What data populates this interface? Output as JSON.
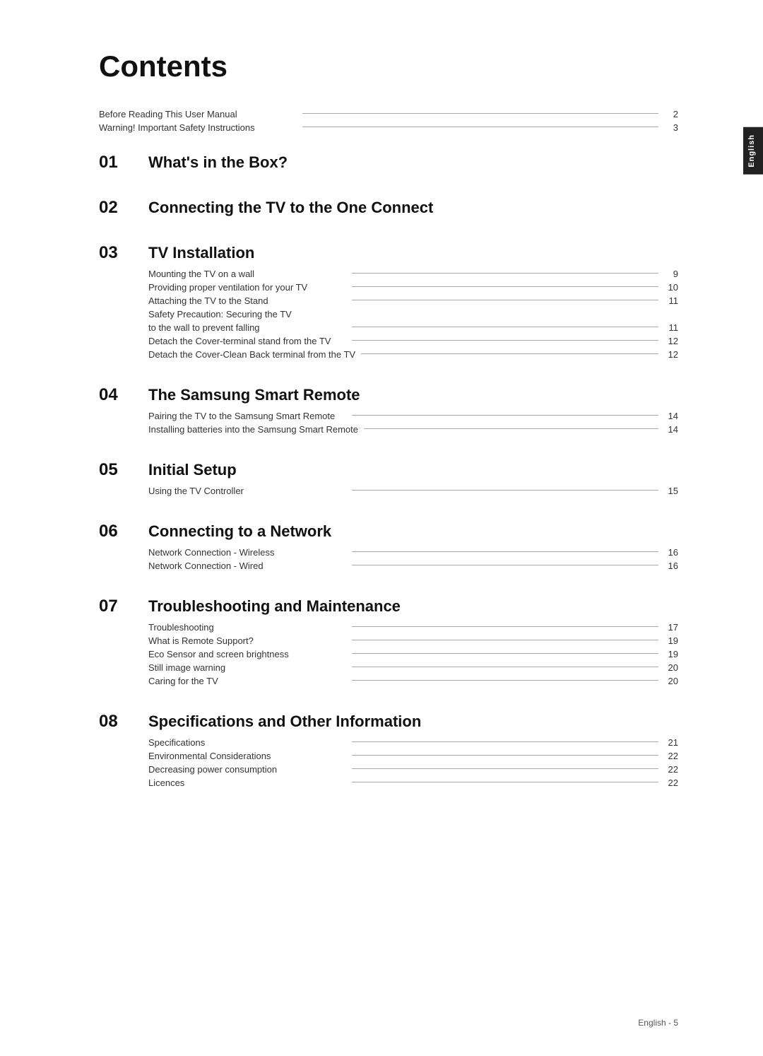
{
  "page": {
    "title": "Contents",
    "footer": "English - 5",
    "side_tab": "English"
  },
  "intro": {
    "items": [
      {
        "label": "Before Reading This User Manual",
        "page": "2"
      },
      {
        "label": "Warning! Important Safety Instructions",
        "page": "3"
      }
    ]
  },
  "sections": [
    {
      "number": "01",
      "title": "What's in the Box?",
      "entries": []
    },
    {
      "number": "02",
      "title": "Connecting the TV to the One Connect",
      "entries": []
    },
    {
      "number": "03",
      "title": "TV Installation",
      "entries": [
        {
          "label": "Mounting the TV on a wall",
          "page": "9"
        },
        {
          "label": "Providing proper ventilation for your TV",
          "page": "10"
        },
        {
          "label": "Attaching the TV to the Stand",
          "page": "11"
        },
        {
          "label": "Safety Precaution: Securing the TV",
          "page": ""
        },
        {
          "label": "to the wall to prevent falling",
          "page": "11"
        },
        {
          "label": "Detach the Cover-terminal stand from the TV",
          "page": "12"
        },
        {
          "label": "Detach the Cover-Clean Back terminal from the TV",
          "page": "12"
        }
      ]
    },
    {
      "number": "04",
      "title": "The Samsung Smart Remote",
      "entries": [
        {
          "label": "Pairing the TV to the Samsung Smart Remote",
          "page": "14"
        },
        {
          "label": "Installing batteries into the Samsung Smart Remote",
          "page": "14"
        }
      ]
    },
    {
      "number": "05",
      "title": "Initial Setup",
      "entries": [
        {
          "label": "Using the TV Controller",
          "page": "15"
        }
      ]
    },
    {
      "number": "06",
      "title": "Connecting to a Network",
      "entries": [
        {
          "label": "Network Connection - Wireless",
          "page": "16"
        },
        {
          "label": "Network Connection - Wired",
          "page": "16"
        }
      ]
    },
    {
      "number": "07",
      "title": "Troubleshooting and Maintenance",
      "entries": [
        {
          "label": "Troubleshooting",
          "page": "17"
        },
        {
          "label": "What is Remote Support?",
          "page": "19"
        },
        {
          "label": "Eco Sensor and screen brightness",
          "page": "19"
        },
        {
          "label": "Still image warning",
          "page": "20"
        },
        {
          "label": "Caring for the TV",
          "page": "20"
        }
      ]
    },
    {
      "number": "08",
      "title": "Specifications and Other Information",
      "entries": [
        {
          "label": "Specifications",
          "page": "21"
        },
        {
          "label": "Environmental Considerations",
          "page": "22"
        },
        {
          "label": "Decreasing power consumption",
          "page": "22"
        },
        {
          "label": "Licences",
          "page": "22"
        }
      ]
    }
  ]
}
